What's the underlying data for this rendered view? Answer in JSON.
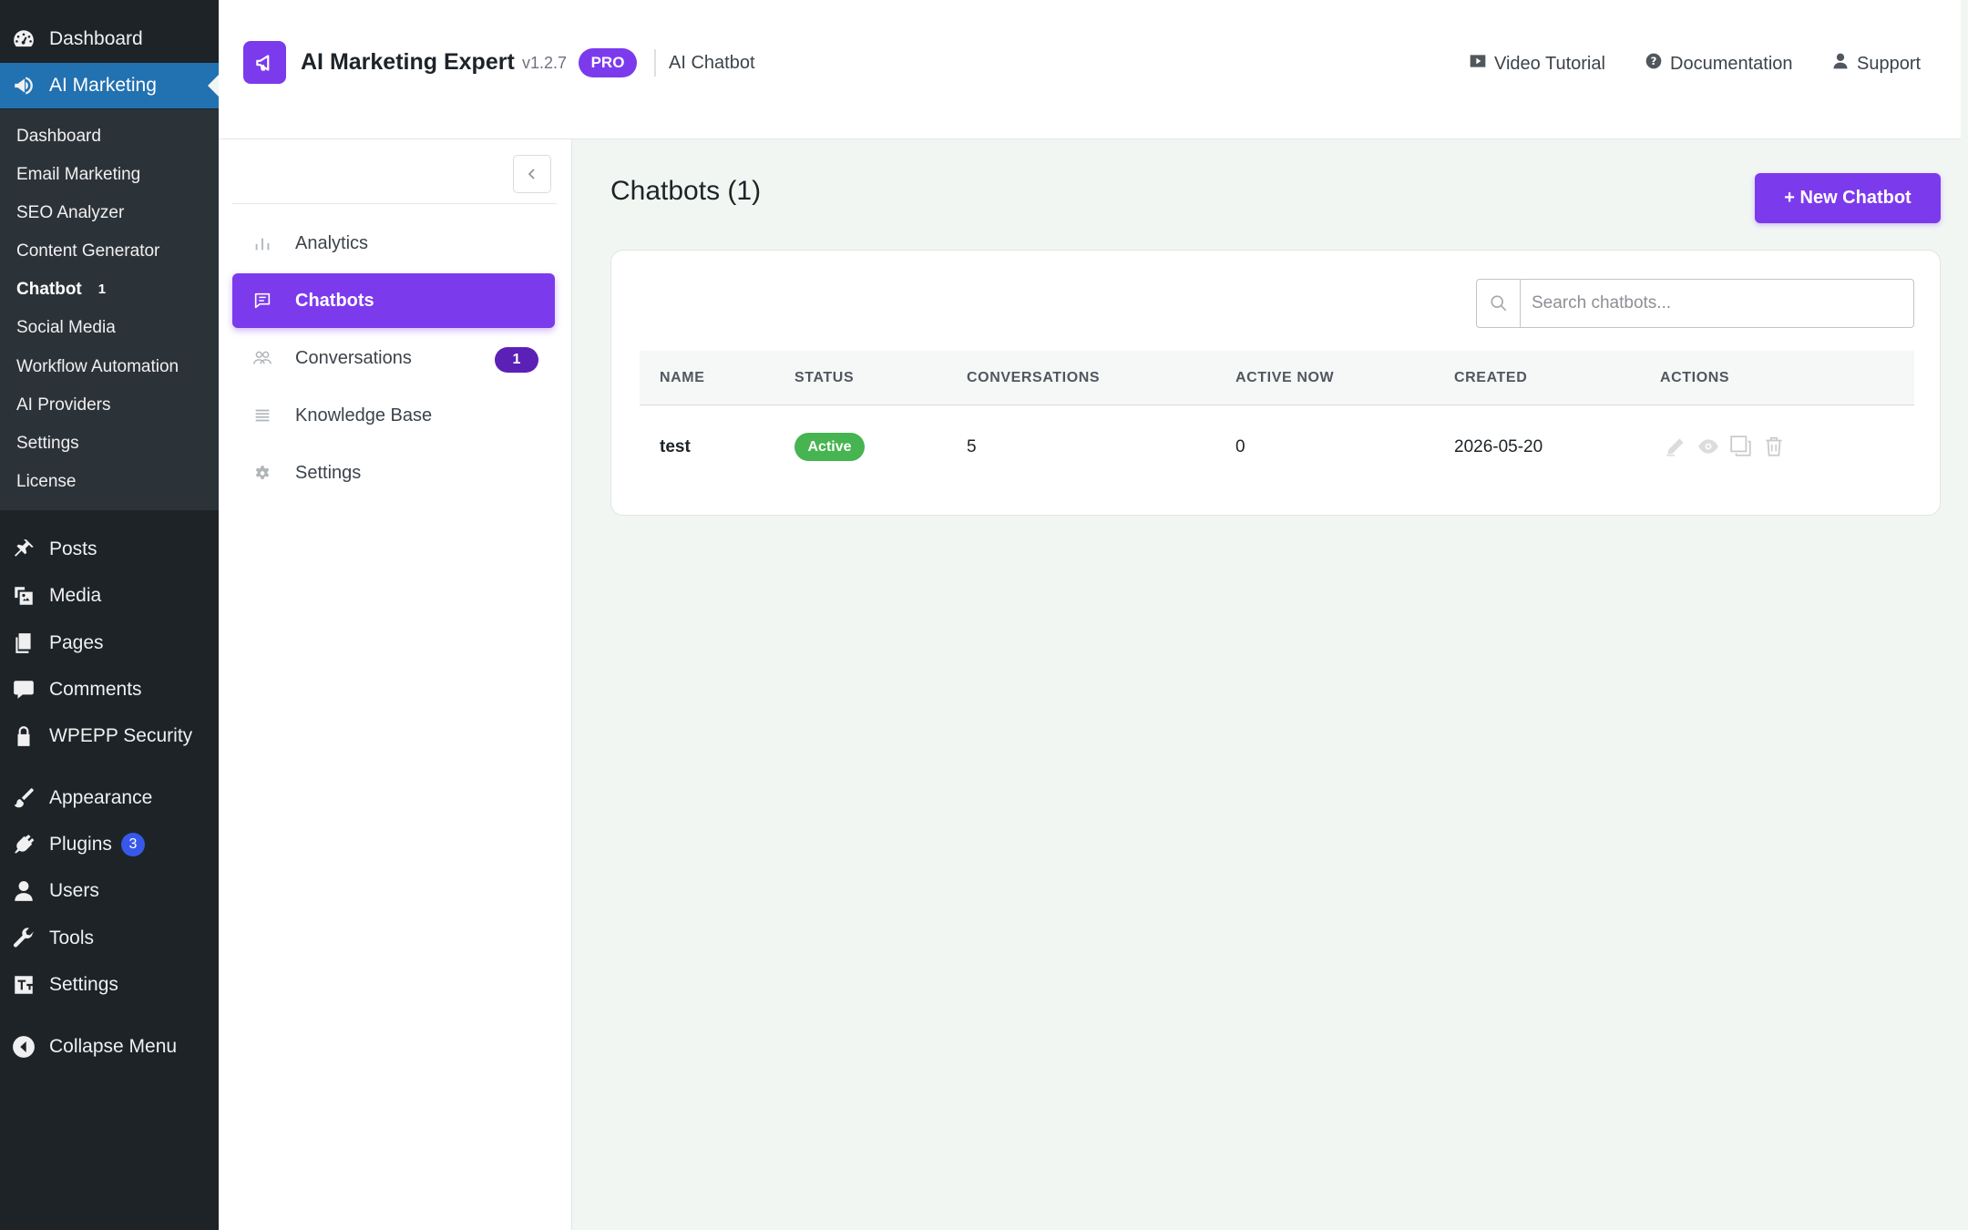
{
  "wp_menu": {
    "top": [
      {
        "label": "Dashboard",
        "icon": "dashboard-icon"
      },
      {
        "label": "AI Marketing",
        "icon": "megaphone-icon",
        "current": true
      }
    ],
    "submenu": [
      {
        "label": "Dashboard"
      },
      {
        "label": "Email Marketing"
      },
      {
        "label": "SEO Analyzer"
      },
      {
        "label": "Content Generator"
      },
      {
        "label": "Chatbot",
        "count": "1",
        "active": true
      },
      {
        "label": "Social Media"
      },
      {
        "label": "Workflow Automation"
      },
      {
        "label": "AI Providers"
      },
      {
        "label": "Settings"
      },
      {
        "label": "License"
      }
    ],
    "items": [
      {
        "label": "Posts",
        "icon": "pin-icon"
      },
      {
        "label": "Media",
        "icon": "media-icon"
      },
      {
        "label": "Pages",
        "icon": "pages-icon"
      },
      {
        "label": "Comments",
        "icon": "comment-icon"
      },
      {
        "label": "WPEPP Security",
        "icon": "lock-icon"
      },
      {
        "label": "Appearance",
        "icon": "brush-icon"
      },
      {
        "label": "Plugins",
        "icon": "plugin-icon",
        "badge": "3"
      },
      {
        "label": "Users",
        "icon": "user-icon"
      },
      {
        "label": "Tools",
        "icon": "wrench-icon"
      },
      {
        "label": "Settings",
        "icon": "settings-icon"
      },
      {
        "label": "Collapse Menu",
        "icon": "collapse-icon"
      }
    ]
  },
  "header": {
    "title": "AI Marketing Expert",
    "version": "v1.2.7",
    "badge": "PRO",
    "section": "AI Chatbot",
    "links": [
      {
        "label": "Video Tutorial",
        "icon": "video-icon"
      },
      {
        "label": "Documentation",
        "icon": "help-icon"
      },
      {
        "label": "Support",
        "icon": "support-icon"
      }
    ]
  },
  "plugin_nav": {
    "items": [
      {
        "label": "Analytics",
        "icon": "analytics-icon"
      },
      {
        "label": "Chatbots",
        "icon": "chat-icon",
        "active": true
      },
      {
        "label": "Conversations",
        "icon": "conversations-icon",
        "count": "1"
      },
      {
        "label": "Knowledge Base",
        "icon": "knowledge-icon"
      },
      {
        "label": "Settings",
        "icon": "gear-icon"
      }
    ]
  },
  "main": {
    "title": "Chatbots (1)",
    "new_button": "+ New Chatbot",
    "search_placeholder": "Search chatbots...",
    "search_value": "",
    "columns": [
      "NAME",
      "STATUS",
      "CONVERSATIONS",
      "ACTIVE NOW",
      "CREATED",
      "ACTIONS"
    ],
    "rows": [
      {
        "name": "test",
        "status": "Active",
        "conversations": "5",
        "active_now": "0",
        "created": "2026-05-20"
      }
    ],
    "actions": [
      "edit-icon",
      "preview-icon",
      "duplicate-icon",
      "delete-icon"
    ]
  },
  "colors": {
    "accent": "#7c3aed",
    "wp_sidebar": "#1d2327",
    "wp_current": "#2271b1",
    "status_active": "#46b450",
    "page_bg": "#f1f6f3"
  }
}
